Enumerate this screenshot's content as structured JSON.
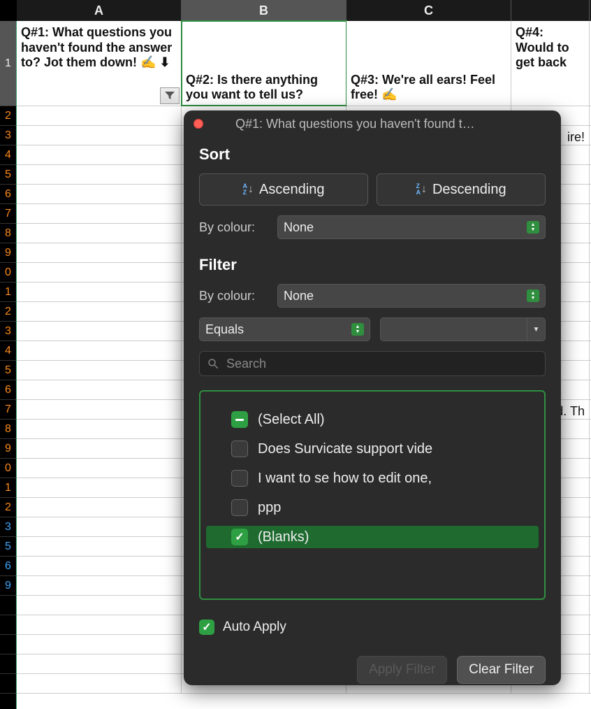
{
  "columns": [
    {
      "letter": "A",
      "header": "Q#1: What questions you haven't found the answer to? Jot them down! ✍️ ⬇︎"
    },
    {
      "letter": "B",
      "header": "Q#2: Is there anything you want to tell us?"
    },
    {
      "letter": "C",
      "header": "Q#3: We're all ears! Feel free! ✍️"
    },
    {
      "letter": "",
      "header": "Q#4: Would to get back"
    }
  ],
  "row_numbers": [
    1,
    2,
    3,
    4,
    5,
    6,
    7,
    8,
    9,
    0,
    1,
    2,
    3,
    4,
    5,
    6,
    7,
    8,
    9,
    0,
    1,
    2,
    3,
    5,
    6,
    9
  ],
  "filtered_rows_last_n": 4,
  "fragments": {
    "row6_text": "ire!",
    "row16_text": "d. Th"
  },
  "popover": {
    "title": "Q#1: What questions you haven't found t…",
    "sort": {
      "label": "Sort",
      "asc": "Ascending",
      "desc": "Descending",
      "by_colour_label": "By colour:",
      "by_colour_value": "None"
    },
    "filter": {
      "label": "Filter",
      "by_colour_label": "By colour:",
      "by_colour_value": "None",
      "operator_value": "Equals",
      "operand_value": "",
      "search_placeholder": "Search",
      "items": {
        "select_all": "(Select All)",
        "i1": "Does Survicate support vide",
        "i2": "I want to se how to edit one,",
        "i3": "ppp",
        "blanks": "(Blanks)"
      },
      "auto_apply": "Auto Apply",
      "apply_btn": "Apply Filter",
      "clear_btn": "Clear Filter"
    }
  }
}
